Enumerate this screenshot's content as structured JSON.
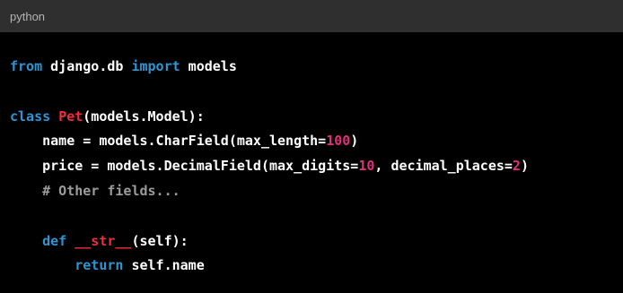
{
  "header": {
    "language": "python"
  },
  "code": {
    "lines": [
      {
        "tokens": [
          {
            "t": "from",
            "k": "kw"
          },
          {
            "t": " django.db ",
            "k": "plain"
          },
          {
            "t": "import",
            "k": "kw"
          },
          {
            "t": " models",
            "k": "plain"
          }
        ]
      },
      {
        "tokens": []
      },
      {
        "tokens": [
          {
            "t": "class",
            "k": "kw"
          },
          {
            "t": " ",
            "k": "plain"
          },
          {
            "t": "Pet",
            "k": "cls"
          },
          {
            "t": "(models.Model):",
            "k": "plain"
          }
        ]
      },
      {
        "tokens": [
          {
            "t": "    name = models.CharField(max_length=",
            "k": "plain"
          },
          {
            "t": "100",
            "k": "num"
          },
          {
            "t": ")",
            "k": "plain"
          }
        ]
      },
      {
        "tokens": [
          {
            "t": "    price = models.DecimalField(max_digits=",
            "k": "plain"
          },
          {
            "t": "10",
            "k": "num"
          },
          {
            "t": ", decimal_places=",
            "k": "plain"
          },
          {
            "t": "2",
            "k": "num"
          },
          {
            "t": ")",
            "k": "plain"
          }
        ]
      },
      {
        "tokens": [
          {
            "t": "    ",
            "k": "plain"
          },
          {
            "t": "# Other fields...",
            "k": "cmt"
          }
        ]
      },
      {
        "tokens": []
      },
      {
        "tokens": [
          {
            "t": "    ",
            "k": "plain"
          },
          {
            "t": "def",
            "k": "kw"
          },
          {
            "t": " ",
            "k": "plain"
          },
          {
            "t": "__str__",
            "k": "cls"
          },
          {
            "t": "(self):",
            "k": "plain"
          }
        ]
      },
      {
        "tokens": [
          {
            "t": "        ",
            "k": "plain"
          },
          {
            "t": "return",
            "k": "kw"
          },
          {
            "t": " self.name",
            "k": "plain"
          }
        ]
      }
    ]
  },
  "colors": {
    "header_bg": "#2f2f2f",
    "code_bg": "#000000",
    "keyword": "#2e95d3",
    "class_name": "#f22c3d",
    "number": "#df3079",
    "comment": "#9c9c9c",
    "text": "#ffffff"
  }
}
